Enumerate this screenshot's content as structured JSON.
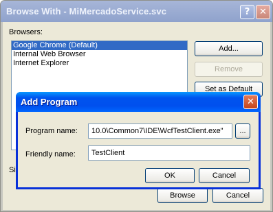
{
  "outer_dialog": {
    "title": "Browse With - MiMercadoService.svc",
    "help_button": "?",
    "close_button": "✕",
    "browsers_label": "Browsers:",
    "browsers": [
      {
        "label": "Google Chrome (Default)",
        "selected": true
      },
      {
        "label": "Internal Web Browser",
        "selected": false
      },
      {
        "label": "Internet Explorer",
        "selected": false
      }
    ],
    "buttons": {
      "add": "Add...",
      "remove": "Remove",
      "set_default": "Set as Default",
      "browse": "Browse",
      "cancel": "Cancel"
    },
    "partial_label": "Si"
  },
  "add_program_dialog": {
    "title": "Add Program",
    "close_button": "✕",
    "program_name_label": "Program name:",
    "program_name_value": "10.0\\Common7\\IDE\\WcfTestClient.exe\"",
    "browse_button": "...",
    "friendly_name_label": "Friendly name:",
    "friendly_name_value": "TestClient",
    "ok_button": "OK",
    "cancel_button": "Cancel"
  }
}
